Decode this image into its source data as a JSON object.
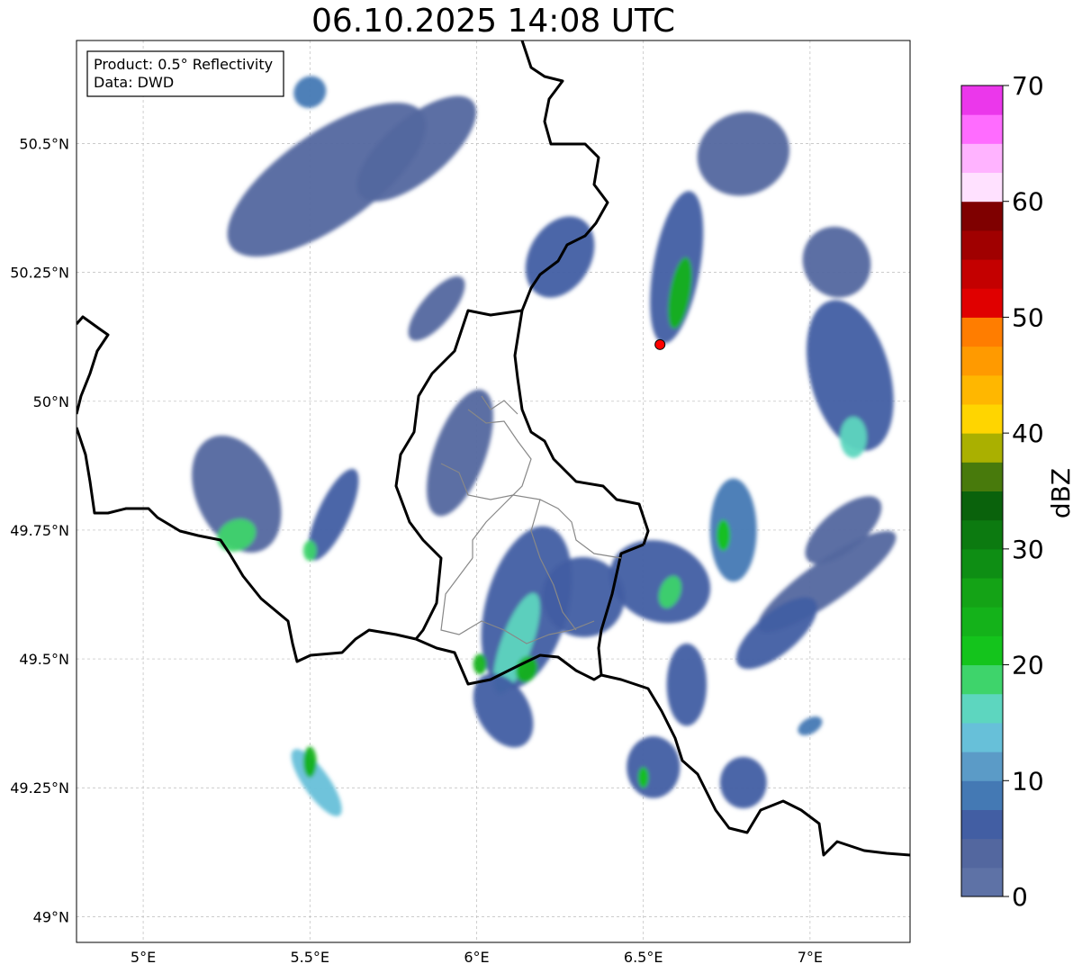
{
  "title": "06.10.2025 14:08 UTC",
  "info_box": {
    "product": "Product: 0.5° Reflectivity",
    "data": "Data: DWD"
  },
  "map": {
    "lon_range": [
      4.8,
      7.3
    ],
    "lat_range": [
      48.95,
      50.7
    ],
    "lon_ticks": [
      {
        "value": 5.0,
        "label": "5°E"
      },
      {
        "value": 5.5,
        "label": "5.5°E"
      },
      {
        "value": 6.0,
        "label": "6°E"
      },
      {
        "value": 6.5,
        "label": "6.5°E"
      },
      {
        "value": 7.0,
        "label": "7°E"
      }
    ],
    "lat_ticks": [
      {
        "value": 49.0,
        "label": "49°N"
      },
      {
        "value": 49.25,
        "label": "49.25°N"
      },
      {
        "value": 49.5,
        "label": "49.5°N"
      },
      {
        "value": 49.75,
        "label": "49.75°N"
      },
      {
        "value": 50.0,
        "label": "50°N"
      },
      {
        "value": 50.25,
        "label": "50.25°N"
      },
      {
        "value": 50.5,
        "label": "50.5°N"
      }
    ],
    "radar_site": {
      "lon": 6.55,
      "lat": 50.11,
      "color": "#ff0000"
    },
    "echoes": [
      {
        "lon": 5.55,
        "lat": 50.43,
        "rx": 0.35,
        "ry": 0.09,
        "rot": -35,
        "dbz": 3
      },
      {
        "lon": 5.82,
        "lat": 50.49,
        "rx": 0.22,
        "ry": 0.06,
        "rot": -40,
        "dbz": 4
      },
      {
        "lon": 5.5,
        "lat": 50.6,
        "rx": 0.05,
        "ry": 0.03,
        "rot": -40,
        "dbz": 8
      },
      {
        "lon": 5.88,
        "lat": 50.18,
        "rx": 0.12,
        "ry": 0.03,
        "rot": -50,
        "dbz": 3
      },
      {
        "lon": 6.25,
        "lat": 50.28,
        "rx": 0.13,
        "ry": 0.06,
        "rot": -60,
        "dbz": 5
      },
      {
        "lon": 6.8,
        "lat": 50.48,
        "rx": 0.14,
        "ry": 0.08,
        "rot": -20,
        "dbz": 3
      },
      {
        "lon": 6.6,
        "lat": 50.26,
        "rx": 0.07,
        "ry": 0.15,
        "rot": 10,
        "dbz": 5
      },
      {
        "lon": 6.61,
        "lat": 50.21,
        "rx": 0.03,
        "ry": 0.07,
        "rot": 10,
        "dbz": 23
      },
      {
        "lon": 7.08,
        "lat": 50.27,
        "rx": 0.1,
        "ry": 0.07,
        "rot": -30,
        "dbz": 4
      },
      {
        "lon": 7.12,
        "lat": 50.05,
        "rx": 0.12,
        "ry": 0.15,
        "rot": -15,
        "dbz": 5
      },
      {
        "lon": 7.13,
        "lat": 49.93,
        "rx": 0.04,
        "ry": 0.04,
        "rot": 0,
        "dbz": 16
      },
      {
        "lon": 7.1,
        "lat": 49.75,
        "rx": 0.14,
        "ry": 0.04,
        "rot": -40,
        "dbz": 3
      },
      {
        "lon": 7.05,
        "lat": 49.65,
        "rx": 0.25,
        "ry": 0.04,
        "rot": -35,
        "dbz": 3
      },
      {
        "lon": 6.9,
        "lat": 49.55,
        "rx": 0.15,
        "ry": 0.04,
        "rot": -40,
        "dbz": 5
      },
      {
        "lon": 5.28,
        "lat": 49.82,
        "rx": 0.12,
        "ry": 0.12,
        "rot": -25,
        "dbz": 4
      },
      {
        "lon": 5.28,
        "lat": 49.74,
        "rx": 0.06,
        "ry": 0.03,
        "rot": -25,
        "dbz": 18
      },
      {
        "lon": 5.57,
        "lat": 49.78,
        "rx": 0.15,
        "ry": 0.03,
        "rot": -65,
        "dbz": 5
      },
      {
        "lon": 5.5,
        "lat": 49.71,
        "rx": 0.02,
        "ry": 0.02,
        "rot": 0,
        "dbz": 18
      },
      {
        "lon": 5.52,
        "lat": 49.26,
        "rx": 0.12,
        "ry": 0.025,
        "rot": -125,
        "dbz": 13
      },
      {
        "lon": 5.5,
        "lat": 49.3,
        "rx": 0.02,
        "ry": 0.03,
        "rot": 0,
        "dbz": 23
      },
      {
        "lon": 5.95,
        "lat": 49.9,
        "rx": 0.2,
        "ry": 0.05,
        "rot": -70,
        "dbz": 4
      },
      {
        "lon": 6.15,
        "lat": 49.6,
        "rx": 0.25,
        "ry": 0.08,
        "rot": -75,
        "dbz": 5
      },
      {
        "lon": 6.12,
        "lat": 49.53,
        "rx": 0.16,
        "ry": 0.03,
        "rot": -70,
        "dbz": 16
      },
      {
        "lon": 6.15,
        "lat": 49.48,
        "rx": 0.04,
        "ry": 0.02,
        "rot": -70,
        "dbz": 23
      },
      {
        "lon": 6.01,
        "lat": 49.49,
        "rx": 0.02,
        "ry": 0.02,
        "rot": 0,
        "dbz": 23
      },
      {
        "lon": 6.08,
        "lat": 49.4,
        "rx": 0.12,
        "ry": 0.05,
        "rot": -120,
        "dbz": 7
      },
      {
        "lon": 6.32,
        "lat": 49.62,
        "rx": 0.12,
        "ry": 0.08,
        "rot": -80,
        "dbz": 5
      },
      {
        "lon": 6.55,
        "lat": 49.65,
        "rx": 0.12,
        "ry": 0.1,
        "rot": -70,
        "dbz": 6
      },
      {
        "lon": 6.58,
        "lat": 49.63,
        "rx": 0.05,
        "ry": 0.02,
        "rot": -70,
        "dbz": 18
      },
      {
        "lon": 6.77,
        "lat": 49.75,
        "rx": 0.07,
        "ry": 0.1,
        "rot": 0,
        "dbz": 8
      },
      {
        "lon": 6.74,
        "lat": 49.74,
        "rx": 0.02,
        "ry": 0.03,
        "rot": 0,
        "dbz": 22
      },
      {
        "lon": 6.63,
        "lat": 49.45,
        "rx": 0.06,
        "ry": 0.08,
        "rot": 0,
        "dbz": 6
      },
      {
        "lon": 6.53,
        "lat": 49.29,
        "rx": 0.08,
        "ry": 0.06,
        "rot": 0,
        "dbz": 5
      },
      {
        "lon": 6.5,
        "lat": 49.27,
        "rx": 0.015,
        "ry": 0.02,
        "rot": 0,
        "dbz": 22
      },
      {
        "lon": 6.8,
        "lat": 49.26,
        "rx": 0.07,
        "ry": 0.05,
        "rot": 0,
        "dbz": 5
      },
      {
        "lon": 7.0,
        "lat": 49.37,
        "rx": 0.04,
        "ry": 0.015,
        "rot": -30,
        "dbz": 8
      }
    ]
  },
  "colorbar": {
    "label": "dBZ",
    "vmin": 0,
    "vmax": 70,
    "ticks": [
      0,
      10,
      20,
      30,
      40,
      50,
      60,
      70
    ],
    "tick_labels": [
      "0",
      "10",
      "20",
      "30",
      "40",
      "50",
      "60",
      "70"
    ],
    "colors": [
      "#5e72a6",
      "#53679f",
      "#425ea3",
      "#4479b4",
      "#5b9bc7",
      "#67c0d9",
      "#5dd6bf",
      "#3ed46b",
      "#14c41c",
      "#14b21a",
      "#14a316",
      "#0e8e14",
      "#0c7a10",
      "#0a620c",
      "#487a0c",
      "#aab000",
      "#ffd500",
      "#ffb700",
      "#ff9a00",
      "#ff7d00",
      "#e00000",
      "#c40000",
      "#a00000",
      "#7f0000",
      "#ffe1ff",
      "#ffb3ff",
      "#ff6cff",
      "#eb37eb"
    ]
  }
}
